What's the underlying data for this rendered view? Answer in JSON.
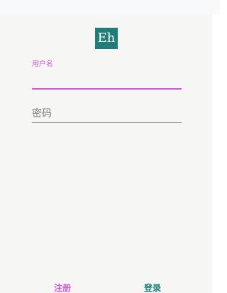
{
  "logo": {
    "text": "Eh"
  },
  "form": {
    "username_label": "用户名",
    "password_placeholder": "密码"
  },
  "actions": {
    "register_label": "注册",
    "login_label": "登录"
  },
  "colors": {
    "accent": "#cc58d2",
    "primary": "#1f7f78",
    "background": "#f6f7f5",
    "topbar": "#f8f9fb"
  }
}
